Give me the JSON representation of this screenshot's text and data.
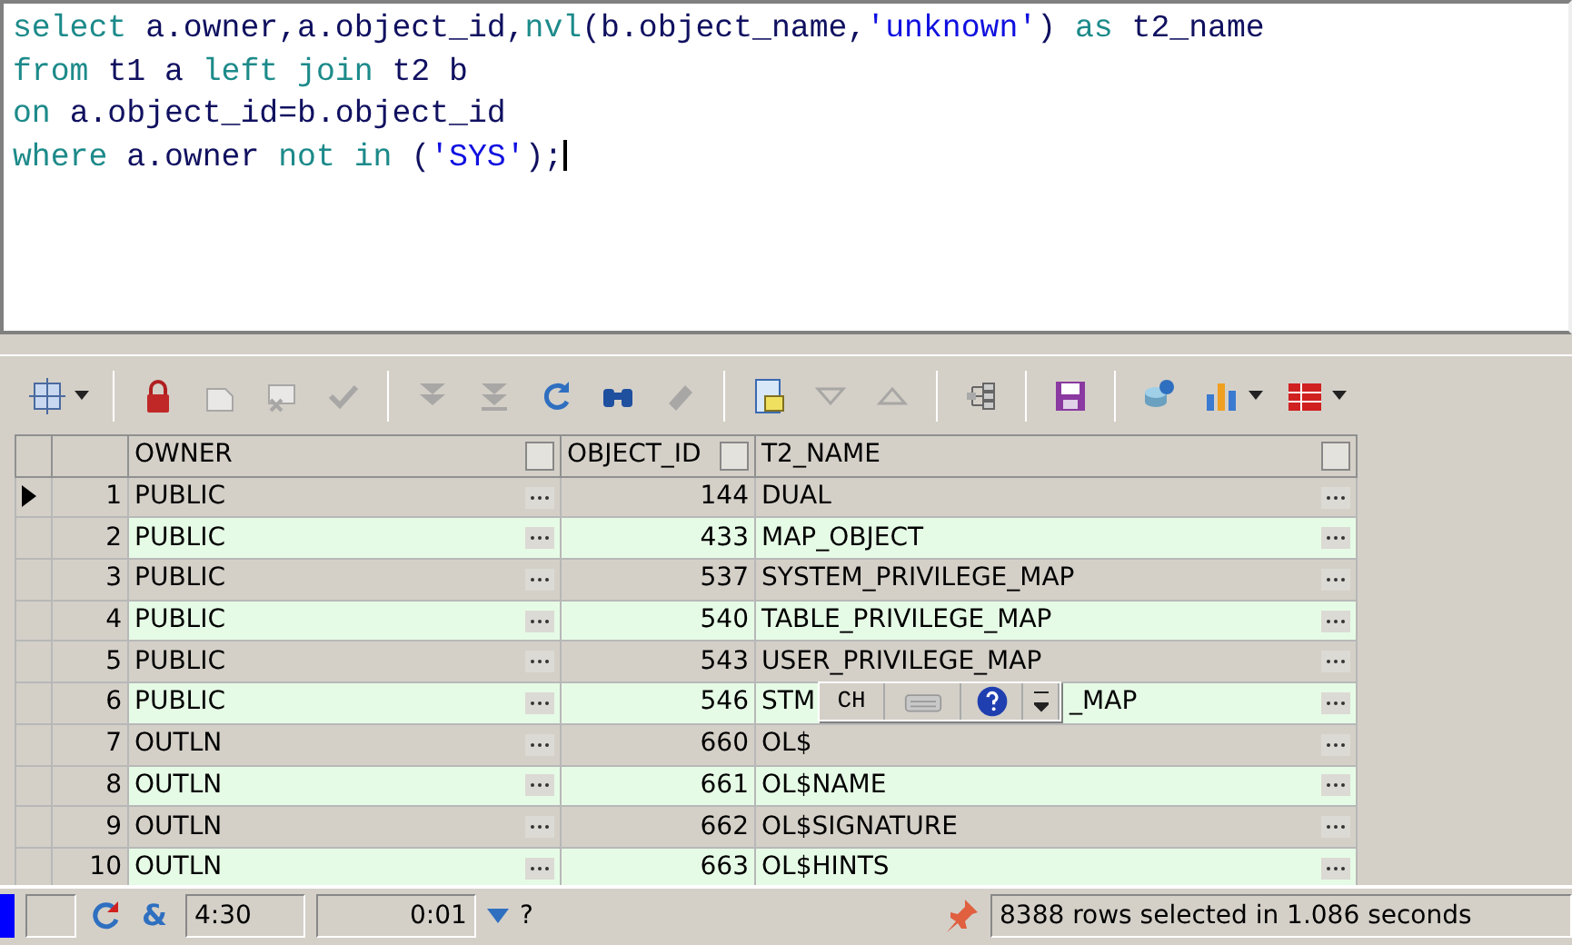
{
  "editor": {
    "lines": [
      [
        {
          "kind": "keyword",
          "text": "select "
        },
        {
          "kind": "ident",
          "text": "a.owner,a.object_id,"
        },
        {
          "kind": "keyword",
          "text": "nvl"
        },
        {
          "kind": "ident",
          "text": "(b.object_name,"
        },
        {
          "kind": "string",
          "text": "'unknown'"
        },
        {
          "kind": "ident",
          "text": ") "
        },
        {
          "kind": "keyword",
          "text": "as "
        },
        {
          "kind": "ident",
          "text": "t2_name"
        }
      ],
      [
        {
          "kind": "keyword",
          "text": "from "
        },
        {
          "kind": "ident",
          "text": "t1 a "
        },
        {
          "kind": "keyword",
          "text": "left join "
        },
        {
          "kind": "ident",
          "text": "t2 b"
        }
      ],
      [
        {
          "kind": "keyword",
          "text": "on "
        },
        {
          "kind": "ident",
          "text": "a.object_id=b.object_id"
        }
      ],
      [
        {
          "kind": "keyword",
          "text": "where "
        },
        {
          "kind": "ident",
          "text": "a.owner "
        },
        {
          "kind": "keyword",
          "text": "not in "
        },
        {
          "kind": "ident",
          "text": "("
        },
        {
          "kind": "string",
          "text": "'SYS'"
        },
        {
          "kind": "ident",
          "text": ");"
        }
      ]
    ]
  },
  "toolbar": [
    {
      "kind": "grid",
      "disabled": false,
      "dropdown": true
    },
    {
      "kind": "separator"
    },
    {
      "kind": "lock",
      "disabled": false
    },
    {
      "kind": "new",
      "disabled": true
    },
    {
      "kind": "delete",
      "disabled": true
    },
    {
      "kind": "check",
      "disabled": true
    },
    {
      "kind": "separator"
    },
    {
      "kind": "last",
      "disabled": true
    },
    {
      "kind": "fetch",
      "disabled": true
    },
    {
      "kind": "refresh",
      "disabled": false
    },
    {
      "kind": "find",
      "disabled": false
    },
    {
      "kind": "eraser",
      "disabled": true
    },
    {
      "kind": "separator"
    },
    {
      "kind": "form",
      "disabled": false
    },
    {
      "kind": "down",
      "disabled": true
    },
    {
      "kind": "up",
      "disabled": true
    },
    {
      "kind": "separator"
    },
    {
      "kind": "tree",
      "disabled": false
    },
    {
      "kind": "separator"
    },
    {
      "kind": "save",
      "disabled": false
    },
    {
      "kind": "separator"
    },
    {
      "kind": "export",
      "disabled": false
    },
    {
      "kind": "chart",
      "disabled": false,
      "dropdown": true
    },
    {
      "kind": "table",
      "disabled": false,
      "dropdown": true
    }
  ],
  "table": {
    "columns": [
      "OWNER",
      "OBJECT_ID",
      "T2_NAME"
    ],
    "rows": [
      {
        "number": "1",
        "selected": true,
        "cells": [
          "PUBLIC",
          "144",
          "DUAL"
        ]
      },
      {
        "number": "2",
        "selected": false,
        "cells": [
          "PUBLIC",
          "433",
          "MAP_OBJECT"
        ]
      },
      {
        "number": "3",
        "selected": false,
        "cells": [
          "PUBLIC",
          "537",
          "SYSTEM_PRIVILEGE_MAP"
        ]
      },
      {
        "number": "4",
        "selected": false,
        "cells": [
          "PUBLIC",
          "540",
          "TABLE_PRIVILEGE_MAP"
        ]
      },
      {
        "number": "5",
        "selected": false,
        "cells": [
          "PUBLIC",
          "543",
          "USER_PRIVILEGE_MAP"
        ]
      },
      {
        "number": "6",
        "selected": false,
        "cells": [
          "PUBLIC",
          "546",
          "STM"
        ]
      },
      {
        "number": "7",
        "selected": false,
        "cells": [
          "OUTLN",
          "660",
          "OL$"
        ]
      },
      {
        "number": "8",
        "selected": false,
        "cells": [
          "OUTLN",
          "661",
          "OL$NAME"
        ]
      },
      {
        "number": "9",
        "selected": false,
        "cells": [
          "OUTLN",
          "662",
          "OL$SIGNATURE"
        ]
      },
      {
        "number": "10",
        "selected": false,
        "cells": [
          "OUTLN",
          "663",
          "OL$HINTS"
        ]
      }
    ]
  },
  "ime_bar": {
    "label": "CH"
  },
  "ime_tail": "_MAP",
  "status_bar": {
    "amp": "&",
    "position": "4:30",
    "time": "0:01",
    "question": "?",
    "message": "8388 rows selected in 1.086 seconds"
  }
}
